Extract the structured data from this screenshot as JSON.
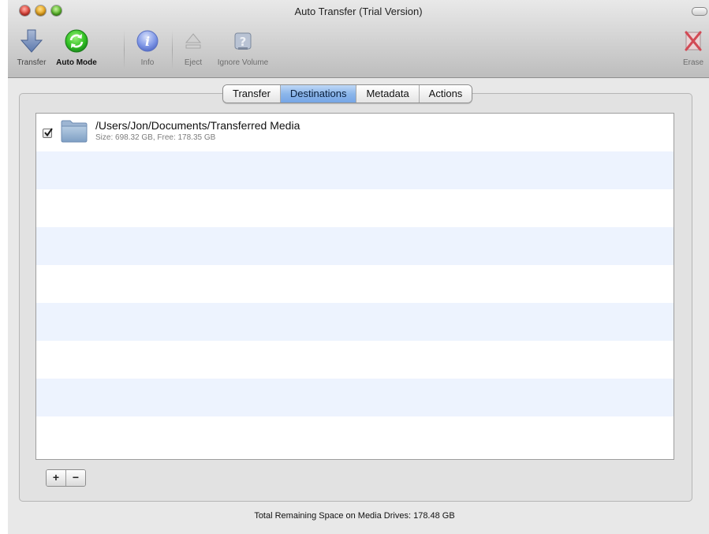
{
  "window": {
    "title": "Auto Transfer (Trial Version)"
  },
  "toolbar": {
    "transfer": "Transfer",
    "auto_mode": "Auto Mode",
    "info": "Info",
    "eject": "Eject",
    "ignore_volume": "Ignore Volume",
    "erase": "Erase"
  },
  "tabs": [
    "Transfer",
    "Destinations",
    "Metadata",
    "Actions"
  ],
  "selected_tab": "Destinations",
  "destinations": [
    {
      "checked": true,
      "path": "/Users/Jon/Documents/Transferred Media",
      "details": "Size: 698.32 GB, Free: 178.35 GB"
    }
  ],
  "list_controls": {
    "add": "+",
    "remove": "−"
  },
  "status": "Total Remaining Space on Media Drives: 178.48 GB",
  "colors": {
    "selected_tab": "#8cb6ea",
    "row_stripe": "#edf3fe",
    "auto_mode_icon": "#32c224",
    "info_icon": "#7f97e6",
    "erase_icon": "#d24a55"
  }
}
